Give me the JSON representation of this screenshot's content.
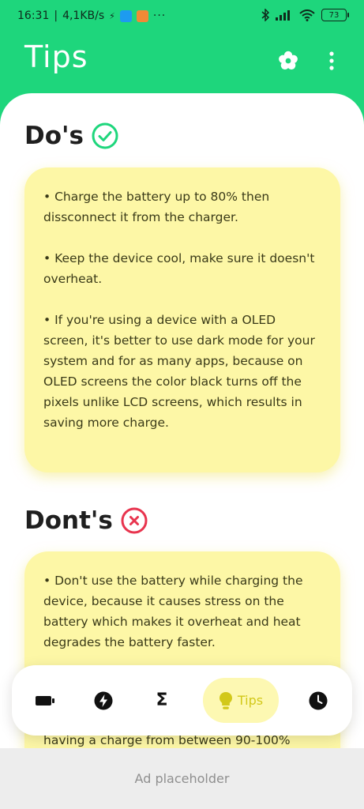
{
  "status_bar": {
    "time": "16:31",
    "separator": "|",
    "speed": "4,1KB/s",
    "dots": "···",
    "battery": "73"
  },
  "appbar": {
    "title": "Tips"
  },
  "dos": {
    "title": "Do's",
    "tips": [
      "• Charge the battery up to 80% then dissconnect it from the charger.",
      "• Keep the device cool, make sure it doesn't overheat.",
      "• If you're using a device with a  OLED screen, it's better to use dark mode for your system and for as many apps, because on OLED screens the color black turns off the pixels unlike LCD screens, which results in saving more charge."
    ]
  },
  "donts": {
    "title": "Dont's",
    "tips": [
      "• Don't use the battery while charging the device, because it causes stress on the battery which makes it overheat and heat degrades the battery faster."
    ],
    "peek_text": "having a charge from between 90-100%"
  },
  "bottom_nav": {
    "items": [
      {
        "icon": "screen-icon"
      },
      {
        "icon": "charge-icon"
      },
      {
        "icon": "sigma-icon",
        "glyph": "Σ"
      },
      {
        "icon": "lightbulb-icon",
        "label": "Tips"
      },
      {
        "icon": "clock-icon"
      }
    ]
  },
  "ad": {
    "label": "Ad placeholder"
  },
  "colors": {
    "accent": "#1ED67C",
    "card": "#FDF7A6",
    "tips_active": "#D2C81A",
    "check": "#1ED67C",
    "cross": "#E8344E"
  }
}
